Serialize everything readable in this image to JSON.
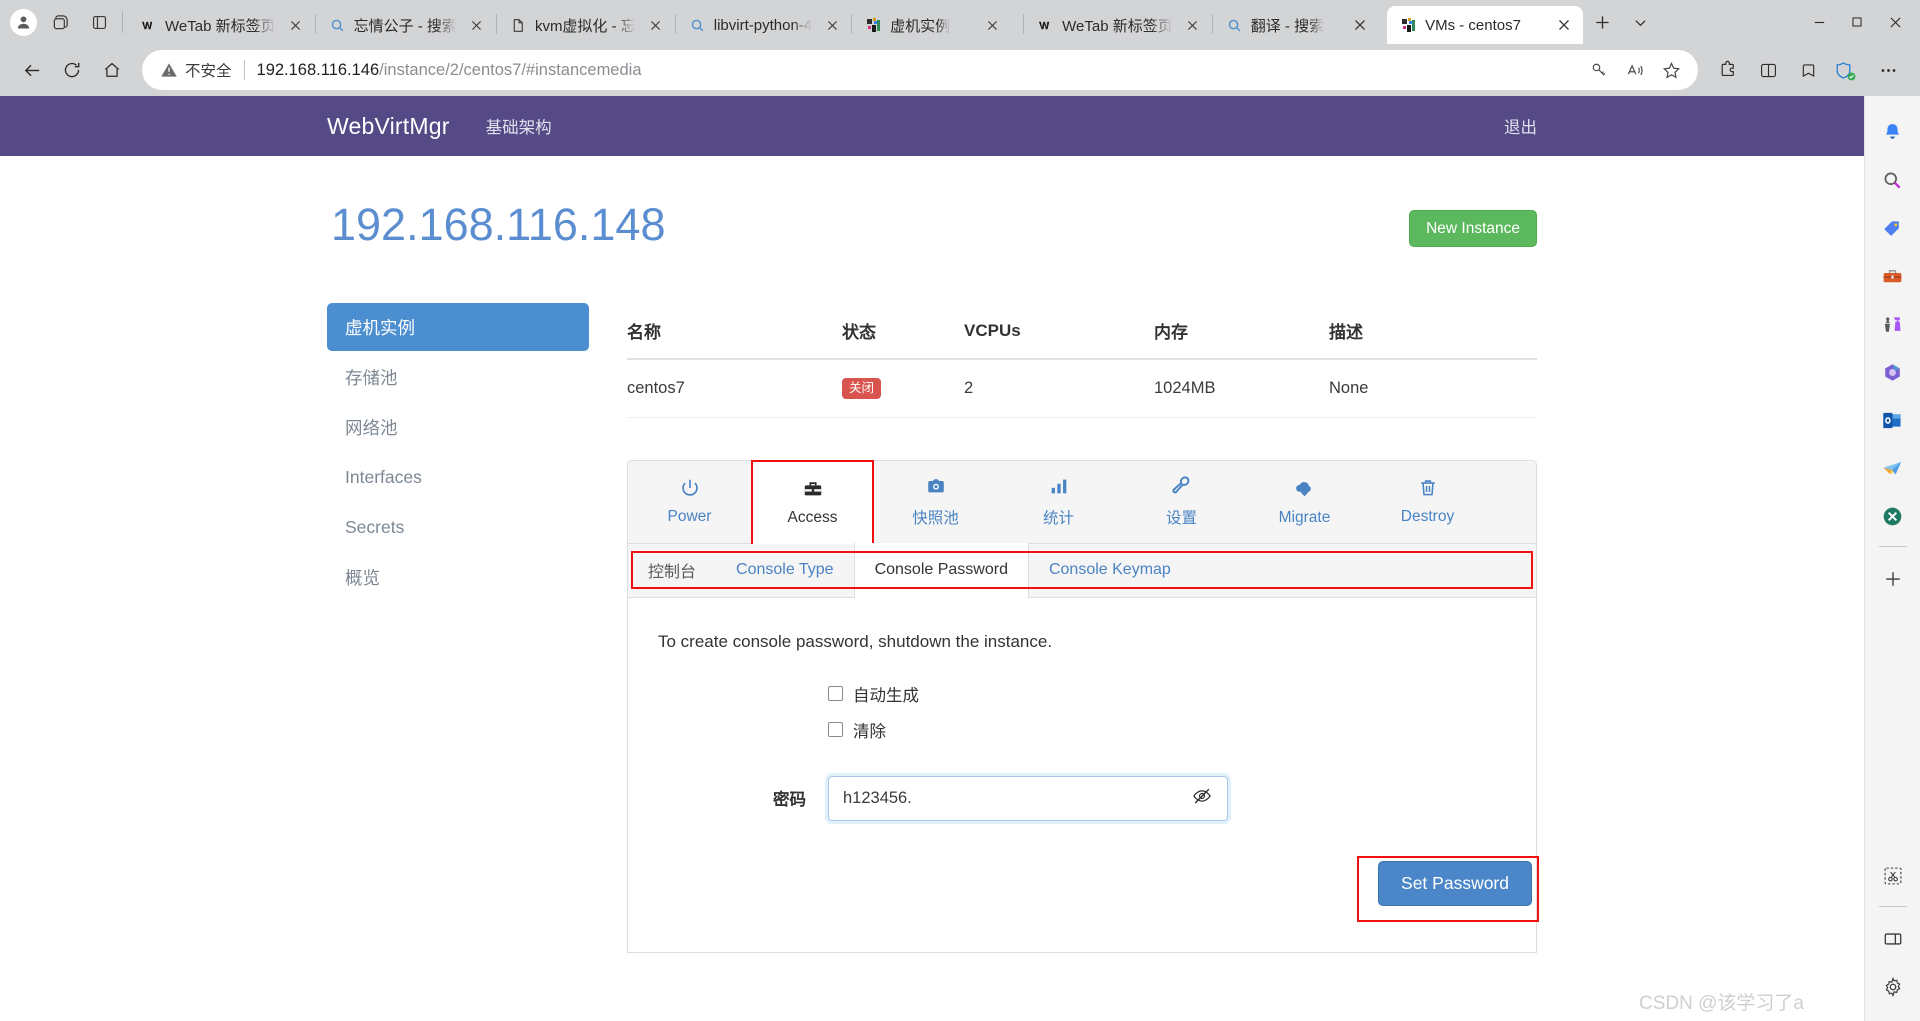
{
  "browser": {
    "tabs": [
      {
        "title": "WeTab 新标签页",
        "icon": "wetab-icon",
        "active": false
      },
      {
        "title": "忘情公子 - 搜索",
        "icon": "search-icon",
        "active": false
      },
      {
        "title": "kvm虚拟化 - 忘",
        "icon": "page-icon",
        "active": false
      },
      {
        "title": "libvirt-python-4",
        "icon": "search-icon",
        "active": false
      },
      {
        "title": "虚机实例",
        "icon": "webvirtmgr-icon",
        "active": false
      },
      {
        "title": "WeTab 新标签页",
        "icon": "wetab-icon",
        "active": false
      },
      {
        "title": "翻译 - 搜索",
        "icon": "search-icon",
        "active": false
      },
      {
        "title": "VMs - centos7",
        "icon": "webvirtmgr-icon",
        "active": true
      }
    ],
    "new_tab_label": "+",
    "tab_list_label": "v",
    "window_minimize": "—",
    "window_maximize": "□",
    "window_close": "✕",
    "nav": {
      "back": "back-button",
      "refresh": "refresh-button",
      "home": "home-button"
    },
    "omnibox": {
      "security_label": "不安全",
      "url_host": "192.168.116.146",
      "url_path": "/instance/2/centos7/#instancemedia",
      "actions": [
        "key-icon",
        "read-aloud-icon",
        "favorite-icon"
      ]
    },
    "toolbar_right": [
      "extensions-icon",
      "split-screen-icon",
      "collections-icon",
      "browser-essentials-icon",
      "settings-more-icon"
    ],
    "sidebar_icons": [
      "copilot-bell-icon",
      "search-icon",
      "shopping-tag-icon",
      "tools-icon",
      "games-icon",
      "office-icon",
      "outlook-icon",
      "telegram-icon",
      "xbox-icon",
      "add-icon",
      "screenshot-icon",
      "split-pane-icon",
      "sidebar-settings-icon"
    ]
  },
  "app": {
    "brand": "WebVirtMgr",
    "nav_link": "基础架构",
    "logout": "退出",
    "page_title": "192.168.116.148",
    "new_instance_button": "New Instance"
  },
  "sidebar": {
    "items": [
      {
        "label": "虚机实例",
        "active": true
      },
      {
        "label": "存储池",
        "active": false
      },
      {
        "label": "网络池",
        "active": false
      },
      {
        "label": "Interfaces",
        "active": false
      },
      {
        "label": "Secrets",
        "active": false
      },
      {
        "label": "概览",
        "active": false
      }
    ]
  },
  "table": {
    "headers": [
      "名称",
      "状态",
      "VCPUs",
      "内存",
      "描述"
    ],
    "rows": [
      {
        "name": "centos7",
        "state": "关闭",
        "vcpus": "2",
        "memory": "1024MB",
        "description": "None"
      }
    ]
  },
  "icon_tabs": [
    {
      "label": "Power",
      "icon": "power-icon",
      "active": false
    },
    {
      "label": "Access",
      "icon": "toolbox-icon",
      "active": true
    },
    {
      "label": "快照池",
      "icon": "camera-icon",
      "active": false
    },
    {
      "label": "统计",
      "icon": "bar-chart-icon",
      "active": false
    },
    {
      "label": "设置",
      "icon": "wrench-icon",
      "active": false
    },
    {
      "label": "Migrate",
      "icon": "cloud-download-icon",
      "active": false
    },
    {
      "label": "Destroy",
      "icon": "trash-icon",
      "active": false
    }
  ],
  "sub_tabs": [
    {
      "label": "控制台",
      "active": false
    },
    {
      "label": "Console Type",
      "active": false
    },
    {
      "label": "Console Password",
      "active": true
    },
    {
      "label": "Console Keymap",
      "active": false
    }
  ],
  "form": {
    "note": "To create console password, shutdown the instance.",
    "auto_generate_label": "自动生成",
    "auto_generate_checked": false,
    "clear_label": "清除",
    "clear_checked": false,
    "password_label": "密码",
    "password_value": "h123456.",
    "password_toggle_icon": "eye-slash-icon",
    "submit_label": "Set Password"
  },
  "watermark": "CSDN @该学习了a",
  "colors": {
    "navbar": "#554a85",
    "title_blue": "#5b8ed0",
    "green_button": "#5cb85c",
    "blue_button": "#4a86c8",
    "danger_badge": "#d9534f",
    "highlight_red": "#f01010",
    "sidebar_active": "#4c8fd0"
  }
}
